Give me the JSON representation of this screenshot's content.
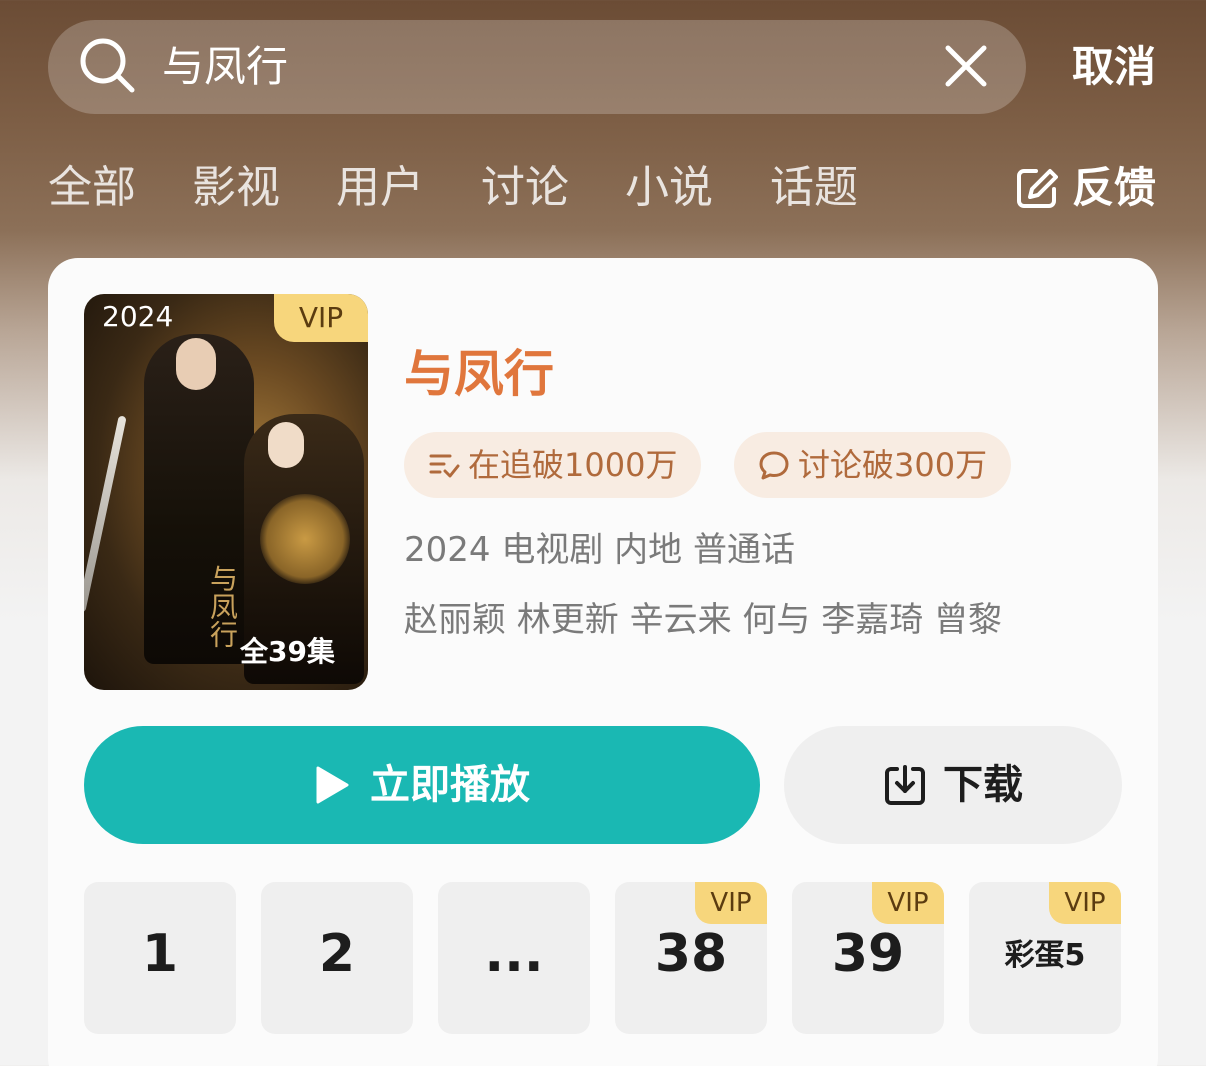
{
  "search": {
    "query": "与凤行",
    "cancel_label": "取消",
    "search_icon": "search-icon",
    "clear_icon": "close-icon"
  },
  "tabs": [
    {
      "label": "全部"
    },
    {
      "label": "影视"
    },
    {
      "label": "用户"
    },
    {
      "label": "讨论"
    },
    {
      "label": "小说"
    },
    {
      "label": "话题"
    }
  ],
  "feedback": {
    "label": "反馈",
    "icon": "edit-icon"
  },
  "show": {
    "poster_year": "2024",
    "poster_vip": "VIP",
    "poster_episodes": "全39集",
    "title": "与凤行",
    "stats": [
      {
        "text": "在追破1000万",
        "icon": "follow-list-icon"
      },
      {
        "text": "讨论破300万",
        "icon": "comment-icon"
      }
    ],
    "meta": "2024 电视剧 内地 普通话",
    "cast": "赵丽颖 林更新 辛云来 何与 李嘉琦 曾黎",
    "accent_color": "#e0763c"
  },
  "actions": {
    "play_label": "立即播放",
    "download_label": "下载",
    "play_color": "#1ab8b3"
  },
  "episodes": [
    {
      "label": "1",
      "vip": ""
    },
    {
      "label": "2",
      "vip": ""
    },
    {
      "label": "...",
      "vip": ""
    },
    {
      "label": "38",
      "vip": "VIP"
    },
    {
      "label": "39",
      "vip": "VIP"
    },
    {
      "label": "彩蛋5",
      "vip": "VIP"
    }
  ]
}
